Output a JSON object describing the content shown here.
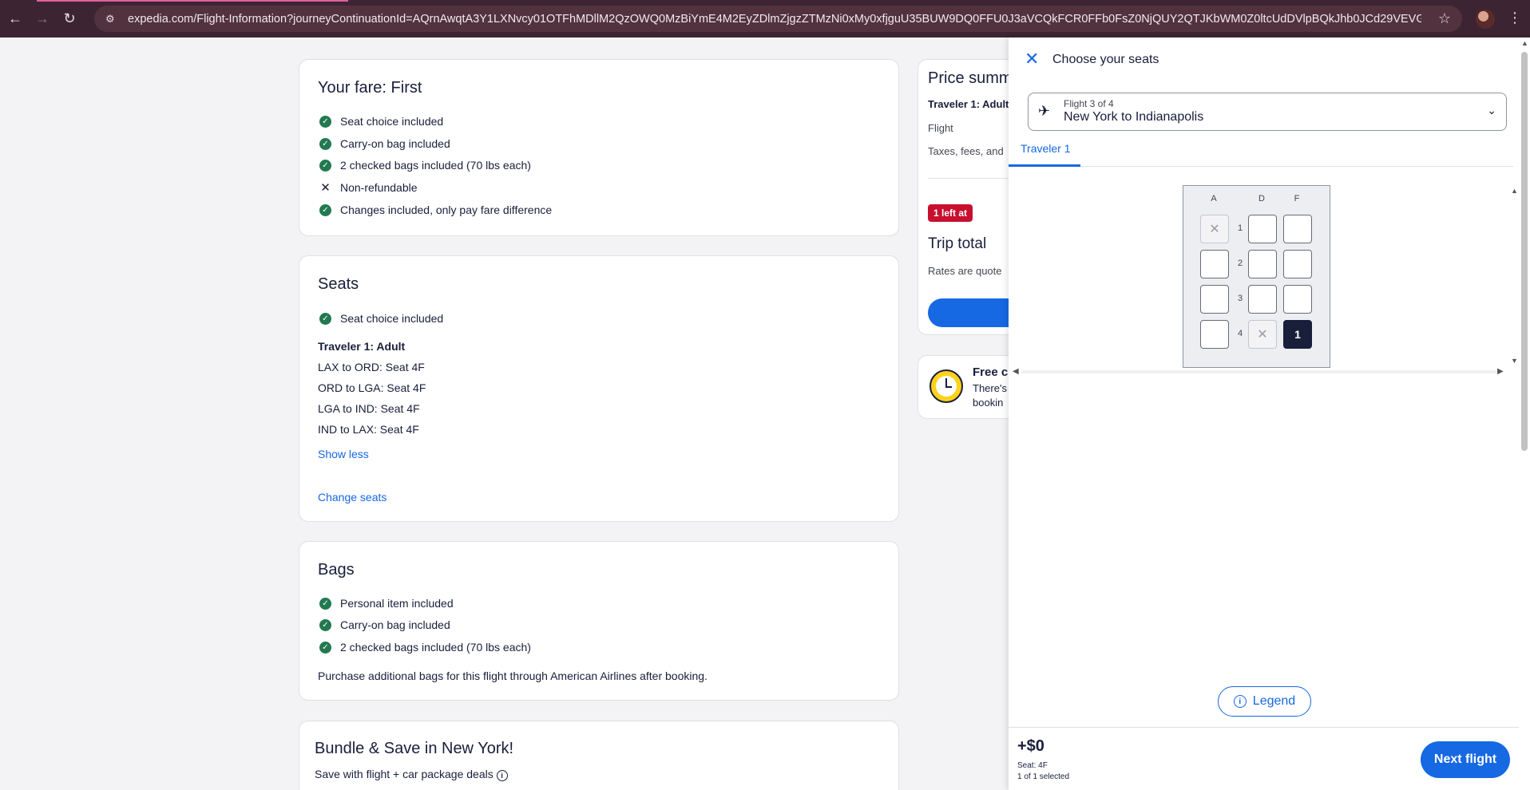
{
  "browser": {
    "url": "expedia.com/Flight-Information?journeyContinuationId=AQrnAwqtA3Y1LXNvcy01OTFhMDllM2QzOWQ0MzBiYmE4M2EyZDlmZjgzZTMzNi0xMy0xfjguU35BUW9DQ0FFU0J3aVCQkFCR0FFb0FsZ0NjQUY2QTJKbWM0Z0ltcUdDVlpBQkJhb0JCd29VEVGWUVBR3lBUWN..."
  },
  "fare": {
    "title": "Your fare: First",
    "items": [
      {
        "icon": "check",
        "text": "Seat choice included"
      },
      {
        "icon": "check",
        "text": "Carry-on bag included"
      },
      {
        "icon": "check",
        "text": "2 checked bags included (70 lbs each)"
      },
      {
        "icon": "x",
        "text": "Non-refundable"
      },
      {
        "icon": "check",
        "text": "Changes included, only pay fare difference"
      }
    ]
  },
  "seats": {
    "title": "Seats",
    "included": "Seat choice included",
    "traveler": "Traveler 1: Adult",
    "legs": [
      "LAX to ORD: Seat 4F",
      "ORD to LGA: Seat 4F",
      "LGA to IND: Seat 4F",
      "IND to LAX: Seat 4F"
    ],
    "show_less": "Show less",
    "change": "Change seats"
  },
  "bags": {
    "title": "Bags",
    "items": [
      "Personal item included",
      "Carry-on bag included",
      "2 checked bags included (70 lbs each)"
    ],
    "note": "Purchase additional bags for this flight through American Airlines after booking."
  },
  "bundle": {
    "title": "Bundle & Save in New York!",
    "subtitle": "Save with flight + car package deals"
  },
  "price_summary": {
    "title": "Price summ",
    "traveler": "Traveler 1: Adult",
    "flight": "Flight",
    "taxes": "Taxes, fees, and",
    "badge": "1 left at",
    "trip_total": "Trip total",
    "rates": "Rates are quote"
  },
  "free_cancel": {
    "title": "Free c",
    "line1": "There's",
    "line2": "bookin"
  },
  "panel": {
    "title": "Choose your seats",
    "flight_sub": "Flight 3 of 4",
    "flight_main": "New York to Indianapolis",
    "traveler_tab": "Traveler 1",
    "columns": [
      "A",
      "D",
      "F"
    ],
    "rows": [
      "1",
      "2",
      "3",
      "4"
    ],
    "selected_label": "1",
    "legend": "Legend",
    "price": "+$0",
    "seat_info": "Seat: 4F",
    "selection_info": "1 of 1 selected",
    "next": "Next flight"
  }
}
